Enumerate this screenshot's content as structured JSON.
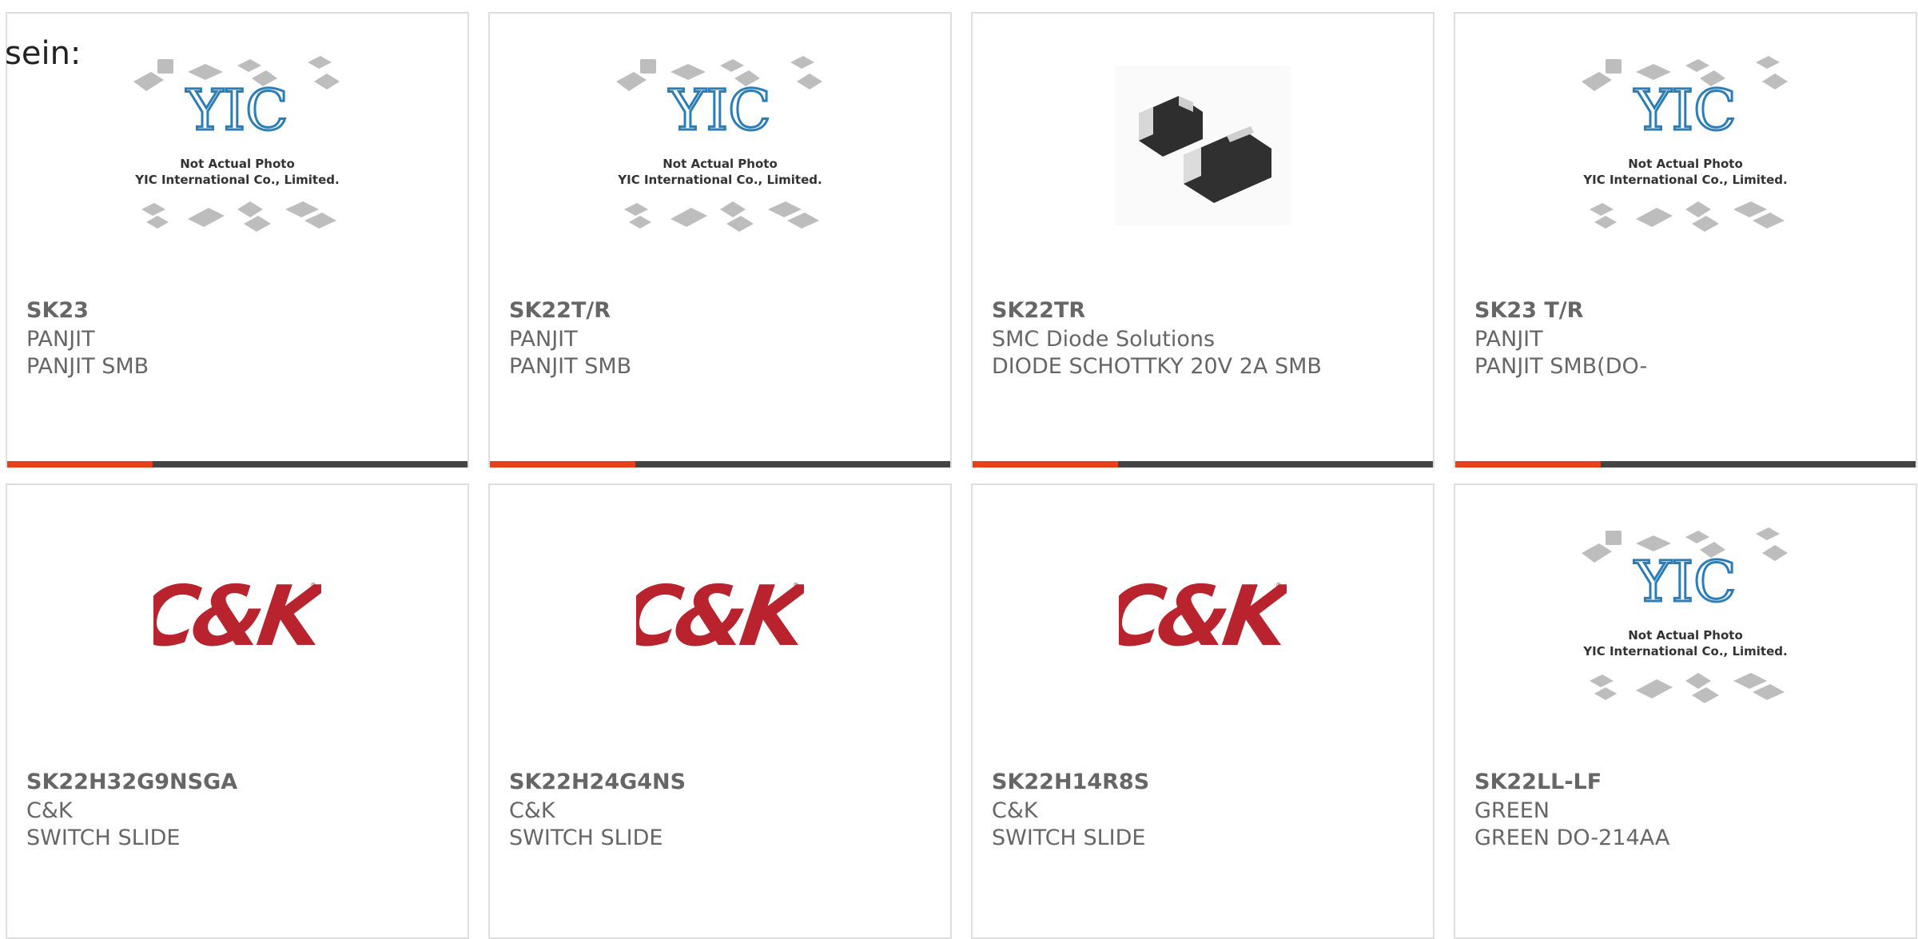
{
  "lead_text": "sein:",
  "colors": {
    "accent": "#e8411a",
    "bar": "#444444",
    "text": "#666666",
    "ck_red": "#b8232d"
  },
  "placeholder": {
    "line1": "Not Actual Photo",
    "line2": "YIC International Co., Limited."
  },
  "products": [
    {
      "part": "SK23",
      "brand": "PANJIT",
      "desc": "PANJIT SMB",
      "image": "yic-placeholder"
    },
    {
      "part": "SK22T/R",
      "brand": "PANJIT",
      "desc": "PANJIT SMB",
      "image": "yic-placeholder"
    },
    {
      "part": "SK22TR",
      "brand": "SMC Diode Solutions",
      "desc": "DIODE SCHOTTKY 20V 2A SMB",
      "image": "diode-photo"
    },
    {
      "part": "SK23 T/R",
      "brand": "PANJIT",
      "desc": "PANJIT SMB(DO-",
      "image": "yic-placeholder"
    },
    {
      "part": "SK22H32G9NSGA",
      "brand": "C&K",
      "desc": "SWITCH SLIDE",
      "image": "ck-logo"
    },
    {
      "part": "SK22H24G4NS",
      "brand": "C&K",
      "desc": "SWITCH SLIDE",
      "image": "ck-logo"
    },
    {
      "part": "SK22H14R8S",
      "brand": "C&K",
      "desc": "SWITCH SLIDE",
      "image": "ck-logo"
    },
    {
      "part": "SK22LL-LF",
      "brand": "GREEN",
      "desc": "GREEN DO-214AA",
      "image": "yic-placeholder"
    }
  ]
}
